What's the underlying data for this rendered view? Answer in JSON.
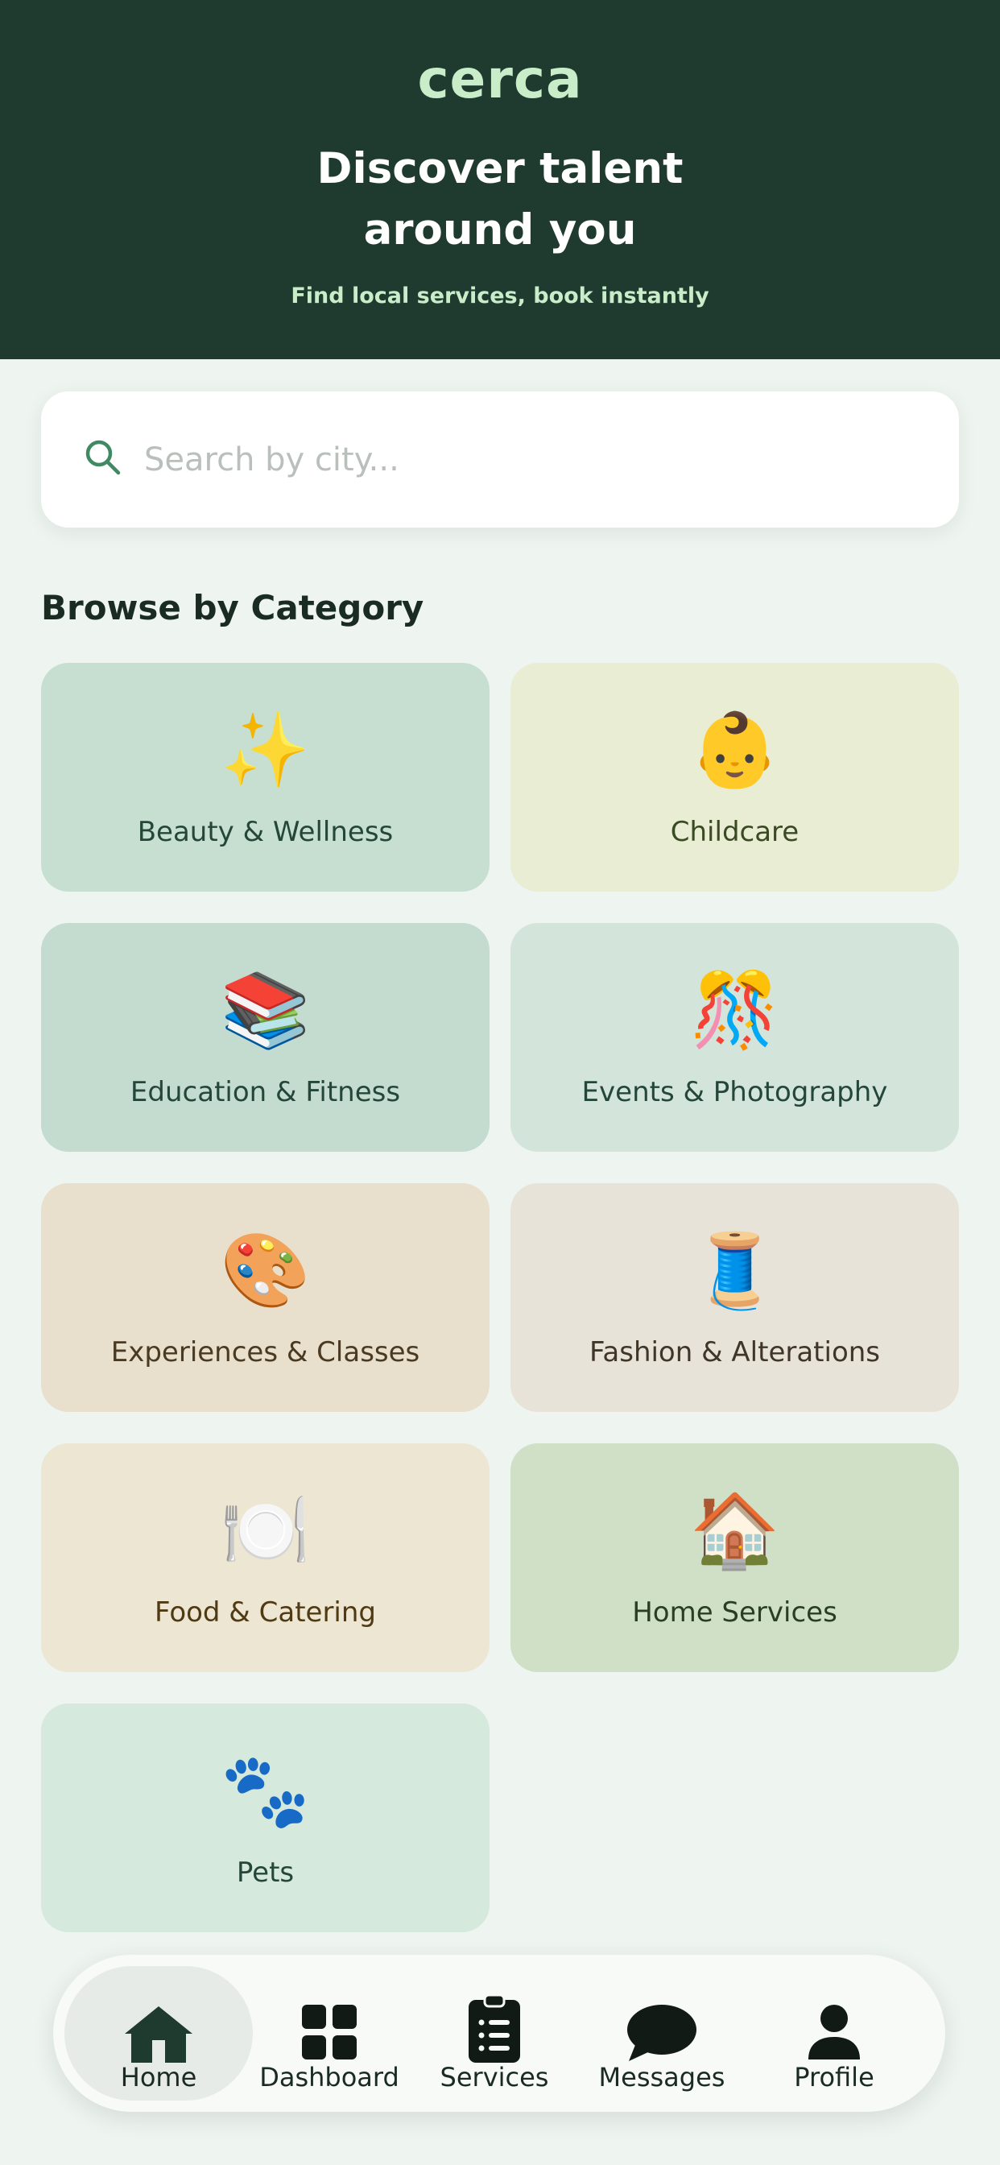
{
  "header": {
    "logo": "cerca",
    "headline": "Discover talent around you",
    "subline": "Find local services, book instantly"
  },
  "search": {
    "placeholder": "Search by city...",
    "icon": "search-icon"
  },
  "categories": {
    "title": "Browse by Category",
    "items": [
      {
        "label": "Beauty & Wellness",
        "emoji": "✨",
        "bg": "#c6dfd1",
        "color": "#24473a"
      },
      {
        "label": "Childcare",
        "emoji": "👶",
        "bg": "#e8edd4",
        "color": "#3a4a22"
      },
      {
        "label": "Education & Fitness",
        "emoji": "📚",
        "bg": "#c3dccf",
        "color": "#24473a"
      },
      {
        "label": "Events & Photography",
        "emoji": "🎊",
        "bg": "#d3e4da",
        "color": "#24473a"
      },
      {
        "label": "Experiences & Classes",
        "emoji": "🎨",
        "bg": "#e8dfcc",
        "color": "#4a3a22"
      },
      {
        "label": "Fashion & Alterations",
        "emoji": "🧵",
        "bg": "#e8e3d8",
        "color": "#3f3528"
      },
      {
        "label": "Food & Catering",
        "emoji": "🍽️",
        "bg": "#ede6d2",
        "color": "#4f3a14"
      },
      {
        "label": "Home Services",
        "emoji": "🏠",
        "bg": "#cfe0c6",
        "color": "#2a3f22"
      },
      {
        "label": "Pets",
        "emoji": "🐾",
        "bg": "#d5e9dd",
        "color": "#24473a"
      }
    ]
  },
  "nav": {
    "items": [
      {
        "label": "Home",
        "icon": "home-icon",
        "active": true
      },
      {
        "label": "Dashboard",
        "icon": "dashboard-icon",
        "active": false
      },
      {
        "label": "Services",
        "icon": "clipboard-icon",
        "active": false
      },
      {
        "label": "Messages",
        "icon": "chat-bubble-icon",
        "active": false
      },
      {
        "label": "Profile",
        "icon": "person-icon",
        "active": false
      }
    ]
  },
  "colors": {
    "header_bg": "#1f3a2e",
    "accent_light": "#c9ecc9",
    "page_bg": "#eef4f0"
  }
}
